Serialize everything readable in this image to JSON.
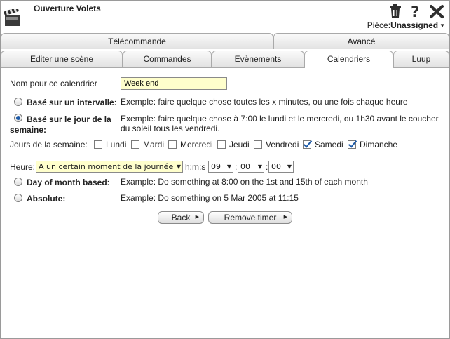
{
  "header": {
    "title": "Ouverture Volets",
    "room_label": "Pièce:",
    "room_value": "Unassigned",
    "icons": [
      "clapperboard-icon",
      "trash-icon",
      "help-icon",
      "close-icon"
    ]
  },
  "tabs_top": [
    {
      "label": "Télécommande"
    },
    {
      "label": "Avancé"
    }
  ],
  "tabs_bottom": [
    {
      "label": "Editer une scène"
    },
    {
      "label": "Commandes"
    },
    {
      "label": "Evènements"
    },
    {
      "label": "Calendriers",
      "active": true
    },
    {
      "label": "Luup"
    }
  ],
  "form": {
    "name_label": "Nom pour ce calendrier",
    "name_value": "Week end",
    "interval": {
      "label": "Basé sur un intervalle:",
      "example": "Exemple: faire quelque chose toutes les x minutes, ou une fois chaque heure",
      "selected": false
    },
    "dayofweek": {
      "label_line1": "Basé sur le jour de la",
      "label_line2": "semaine:",
      "example_line1": "Exemple: faire quelque chose à 7:00 le lundi et le mercredi, ou 1h30 avant le coucher",
      "example_line2": "du soleil tous les vendredi.",
      "selected": true
    },
    "days_label": "Jours de la semaine:",
    "days": [
      {
        "label": "Lundi",
        "checked": false
      },
      {
        "label": "Mardi",
        "checked": false
      },
      {
        "label": "Mercredi",
        "checked": false
      },
      {
        "label": "Jeudi",
        "checked": false
      },
      {
        "label": "Vendredi",
        "checked": false
      },
      {
        "label": "Samedi",
        "checked": true
      },
      {
        "label": "Dimanche",
        "checked": true
      }
    ],
    "heure_label": "Heure:",
    "heure_select": "A un certain moment de la journée",
    "hms_label": "h:m:s",
    "hour": "09",
    "minute": "00",
    "second": "00",
    "time_sep": ":",
    "dayofmonth": {
      "label": "Day of month based:",
      "example": "Example: Do something at 8:00 on the 1st and 15th of each month",
      "selected": false
    },
    "absolute": {
      "label": "Absolute:",
      "example": "Example: Do something on 5 Mar 2005 at 11:15",
      "selected": false
    }
  },
  "buttons": {
    "back": "Back",
    "remove_timer": "Remove timer"
  }
}
